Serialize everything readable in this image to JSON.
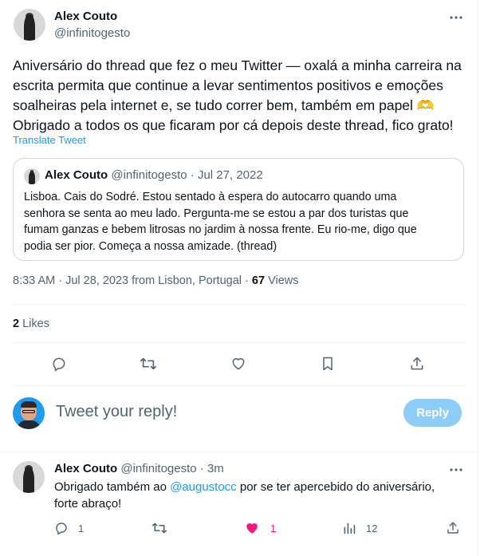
{
  "tweet": {
    "author_name": "Alex Couto",
    "author_handle": "@infinitogesto",
    "text_lines": [
      "Aniversário do thread que fez o meu Twitter — oxalá a minha carreira na",
      "escrita permita que continue a levar sentimentos positivos e emoções",
      "soalheiras pela internet e, se tudo correr bem, também em papel 🫶",
      "Obrigado a todos os que ficaram por cá depois deste thread, fico grato!"
    ],
    "translate_label": "Translate Tweet",
    "time": "8:33 AM",
    "date": "Jul 28, 2023",
    "location": "from Lisbon, Portugal",
    "views_count": "67",
    "views_label": "Views",
    "likes_count": "2",
    "likes_label": "Likes"
  },
  "quote": {
    "author_name": "Alex Couto",
    "author_handle": "@infinitogesto",
    "date": "Jul 27, 2022",
    "text_lines": [
      "Lisboa. Cais do Sodré. Estou sentado à espera do autocarro quando uma",
      "senhora se senta ao meu lado. Pergunta-me se estou a par dos turistas que",
      "fumam ganzas e bebem litrosas no jardim à nossa frente. Eu rio-me, digo que",
      "podia ser pior. Começa a nossa amizade. (thread)"
    ]
  },
  "compose": {
    "placeholder": "Tweet your reply!",
    "reply_button": "Reply"
  },
  "reply": {
    "author_name": "Alex Couto",
    "author_handle": "@infinitogesto",
    "time_ago": "3m",
    "line1_prefix": "Obrigado também ao ",
    "mention": "@augustocc",
    "line1_suffix": " por se ter apercebido do aniversário,",
    "line2": "forte abraço!",
    "reply_count": "1",
    "like_count": "1",
    "view_count": "12"
  },
  "colors": {
    "accent": "#1d9bf0",
    "like_pink": "#f91880",
    "muted": "#536471",
    "reply_button_bg": "#8ecdf7"
  },
  "separators": {
    "dot": "·"
  }
}
